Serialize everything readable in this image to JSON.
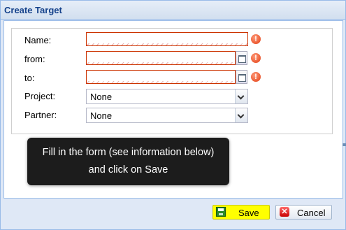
{
  "window": {
    "title": "Create Target"
  },
  "form": {
    "name": {
      "label": "Name:",
      "value": ""
    },
    "from": {
      "label": "from:",
      "value": ""
    },
    "to": {
      "label": "to:",
      "value": ""
    },
    "project": {
      "label": "Project:",
      "value": "None"
    },
    "partner": {
      "label": "Partner:",
      "value": "None"
    },
    "error_glyph": "!"
  },
  "tooltip": {
    "line1": "Fill in the form (see information below)",
    "line2": "and click on Save"
  },
  "buttons": {
    "save": "Save",
    "cancel": "Cancel",
    "cancel_glyph": "✕"
  },
  "colors": {
    "title": "#15428b",
    "error": "#cc3300",
    "save_highlight": "#ffff00",
    "tooltip_bg": "#1c1c1c"
  }
}
